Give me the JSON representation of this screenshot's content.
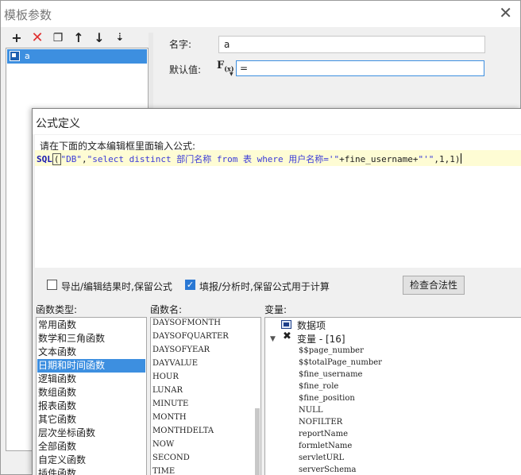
{
  "outer_dialog": {
    "title": "模板参数",
    "close_glyph": "✕",
    "toolbar": {
      "add_glyph": "+",
      "delete_glyph": "✕",
      "copy_glyph": "❐",
      "up_glyph": "↑",
      "down_glyph": "↓",
      "sort_glyph": "⇣"
    },
    "params": [
      {
        "label": "a",
        "selected": true
      }
    ],
    "name_label": "名字:",
    "name_value": "a",
    "default_label": "默认值:",
    "fx_label": "F",
    "fx_sub": "(x)",
    "default_value": "="
  },
  "formula_dialog": {
    "title": "公式定义",
    "hint": "请在下面的文本编辑框里面输入公式:",
    "formula": {
      "fn": "SQL",
      "open": "(",
      "arg1": "\"DB\"",
      "comma1": ",",
      "arg2": "\"select distinct 部门名称 from 表 where 用户名称='\"",
      "plus1": "+fine_username+",
      "arg3": "\"'\"",
      "tail": ",1,1)"
    },
    "export_keep_label": "导出/编辑结果时,保留公式",
    "export_keep_checked": false,
    "fill_keep_label": "填报/分析时,保留公式用于计算",
    "fill_keep_checked": true,
    "check_mark": "✓",
    "check_button": "检查合法性",
    "category_header": "函数类型:",
    "function_header": "函数名:",
    "variable_header": "变量:",
    "categories": [
      {
        "label": "常用函数",
        "selected": false
      },
      {
        "label": "数学和三角函数",
        "selected": false
      },
      {
        "label": "文本函数",
        "selected": false
      },
      {
        "label": "日期和时间函数",
        "selected": true
      },
      {
        "label": "逻辑函数",
        "selected": false
      },
      {
        "label": "数组函数",
        "selected": false
      },
      {
        "label": "报表函数",
        "selected": false
      },
      {
        "label": "其它函数",
        "selected": false
      },
      {
        "label": "层次坐标函数",
        "selected": false
      },
      {
        "label": "全部函数",
        "selected": false
      },
      {
        "label": "自定义函数",
        "selected": false
      },
      {
        "label": "插件函数",
        "selected": false
      }
    ],
    "functions": [
      "DAYSOFMONTH",
      "DAYSOFQUARTER",
      "DAYSOFYEAR",
      "DAYVALUE",
      "HOUR",
      "LUNAR",
      "MINUTE",
      "MONTH",
      "MONTHDELTA",
      "NOW",
      "SECOND",
      "TIME"
    ],
    "variables": {
      "db_label": "数据项",
      "vars_label": "变量 - [16]",
      "toggle_glyph": "▼",
      "vars_icon": "✖",
      "items": [
        "$$page_number",
        "$$totalPage_number",
        "$fine_username",
        "$fine_role",
        "$fine_position",
        "NULL",
        "NOFILTER",
        "reportName",
        "formletName",
        "servletURL",
        "serverSchema"
      ]
    }
  }
}
